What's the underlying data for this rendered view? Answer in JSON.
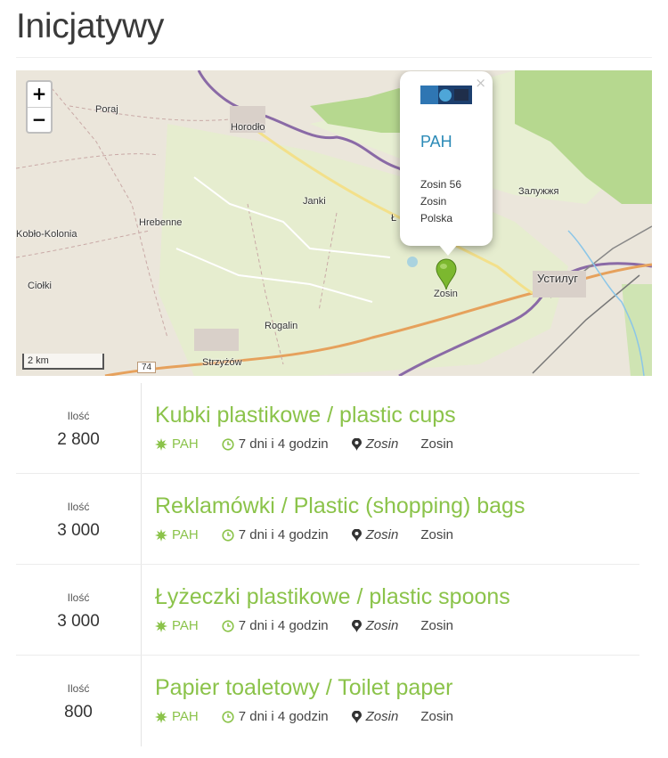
{
  "page": {
    "title": "Inicjatywy"
  },
  "map": {
    "zoom_in": "+",
    "zoom_out": "−",
    "labels": [
      "Poraj",
      "Horodło",
      "Janki",
      "Hrebenne",
      "Kobło-Kolonia",
      "Ciołki",
      "Rogalin",
      "Strzyżów",
      "Zosin",
      "Устилуг",
      "Залужжя",
      "Ł"
    ],
    "scale": "2 km",
    "road_number": "74",
    "popup": {
      "close": "×",
      "name": "PAH",
      "address_line1": "Zosin 56",
      "address_line2": "Zosin",
      "address_line3": "Polska"
    },
    "colors": {
      "marker": "#7cb82f",
      "border_river": "#8a6aa6",
      "forest": "#b6d88f",
      "fields": "#e6edcf"
    }
  },
  "list": {
    "items": [
      {
        "qty_label": "Ilość",
        "qty": "2 800",
        "title": "Kubki plastikowe / plastic cups",
        "org": "PAH",
        "time": "7 dni i 4 godzin",
        "location": "Zosin",
        "city": "Zosin"
      },
      {
        "qty_label": "Ilość",
        "qty": "3 000",
        "title": "Reklamówki / Plastic (shopping) bags",
        "org": "PAH",
        "time": "7 dni i 4 godzin",
        "location": "Zosin",
        "city": "Zosin"
      },
      {
        "qty_label": "Ilość",
        "qty": "3 000",
        "title": "Łyżeczki plastikowe / plastic spoons",
        "org": "PAH",
        "time": "7 dni i 4 godzin",
        "location": "Zosin",
        "city": "Zosin"
      },
      {
        "qty_label": "Ilość",
        "qty": "800",
        "title": "Papier toaletowy / Toilet paper",
        "org": "PAH",
        "time": "7 dni i 4 godzin",
        "location": "Zosin",
        "city": "Zosin"
      }
    ],
    "icons": {
      "org": "starburst-icon",
      "time": "clock-icon",
      "location": "map-pin-icon"
    },
    "accent": "#8bc34a"
  }
}
